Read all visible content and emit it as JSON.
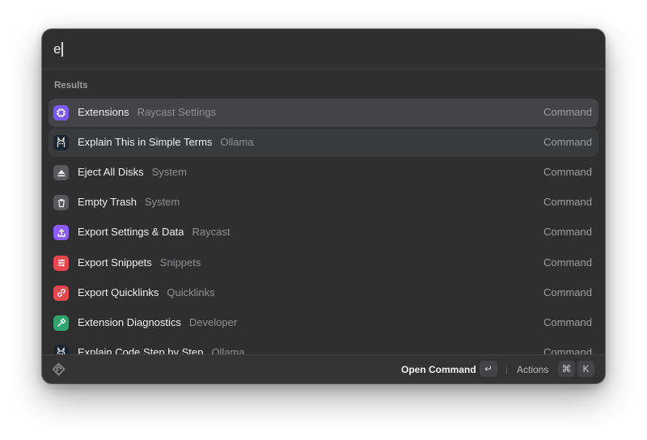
{
  "search": {
    "value": "e"
  },
  "section_title": "Results",
  "results": [
    {
      "title": "Extensions",
      "subtitle": "Raycast Settings",
      "type": "Command",
      "icon": "extensions-icon",
      "icon_bg": "#7a5af8",
      "state": "selected"
    },
    {
      "title": "Explain This in Simple Terms",
      "subtitle": "Ollama",
      "type": "Command",
      "icon": "ollama-icon",
      "icon_bg": "#1c2630",
      "state": "hovered"
    },
    {
      "title": "Eject All Disks",
      "subtitle": "System",
      "type": "Command",
      "icon": "eject-icon",
      "icon_bg": "#5a5a5d",
      "state": ""
    },
    {
      "title": "Empty Trash",
      "subtitle": "System",
      "type": "Command",
      "icon": "trash-icon",
      "icon_bg": "#5a5a5d",
      "state": ""
    },
    {
      "title": "Export Settings & Data",
      "subtitle": "Raycast",
      "type": "Command",
      "icon": "export-icon",
      "icon_bg": "#8b5cf6",
      "state": ""
    },
    {
      "title": "Export Snippets",
      "subtitle": "Snippets",
      "type": "Command",
      "icon": "snippets-icon",
      "icon_bg": "#e5484d",
      "state": ""
    },
    {
      "title": "Export Quicklinks",
      "subtitle": "Quicklinks",
      "type": "Command",
      "icon": "link-icon",
      "icon_bg": "#e5484d",
      "state": ""
    },
    {
      "title": "Extension Diagnostics",
      "subtitle": "Developer",
      "type": "Command",
      "icon": "hammer-icon",
      "icon_bg": "#30a46c",
      "state": ""
    },
    {
      "title": "Explain Code Step by Step",
      "subtitle": "Ollama",
      "type": "Command",
      "icon": "ollama-icon",
      "icon_bg": "#1c2630",
      "state": ""
    }
  ],
  "footer": {
    "logo_icon": "raycast-logo-icon",
    "primary_action": "Open Command",
    "enter_key": "↵",
    "actions_label": "Actions",
    "cmd_key": "⌘",
    "k_key": "K"
  }
}
